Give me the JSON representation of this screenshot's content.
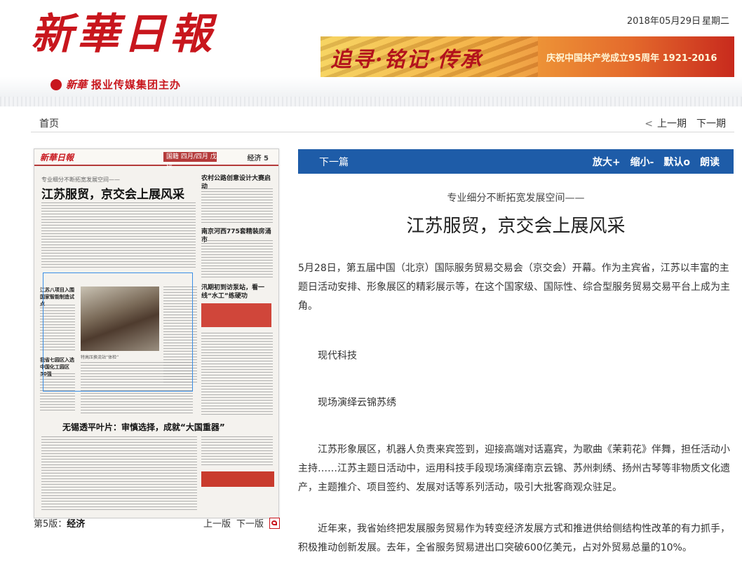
{
  "header": {
    "logo": "新華日報",
    "publisher_mark": "新華",
    "publisher": "报业传媒集团主办",
    "date": "2018年05月29日",
    "weekday": "星期二",
    "banner": {
      "main": "追寻·铭记·传承",
      "side": "庆祝中国共产党成立95周年 1921-2016"
    }
  },
  "nav": {
    "home": "首页",
    "prev_issue": "上一期",
    "next_issue": "下一期"
  },
  "thumbnail": {
    "logo": "新華日報",
    "tag": "国籍 四月/四月 戊戌",
    "edition": "经济 5",
    "kicker": "专业细分不断拓宽发展空间——",
    "headline": "江苏服贸，京交会上展风采",
    "side_headline_1": "农村公路创意设计大赛启动",
    "side_headline_2": "南京河西775套精装房涌市",
    "side_headline_3": "汛期初到访泵站，看一线“水工”练硬功",
    "brief_1": "江苏八项目入围国家智能制造试点",
    "brief_2": "我省七园区入选中国化工园区30强",
    "photo_caption": "特高压换流站“体检”",
    "bottom_headline": "无锡透平叶片：审慎选择，成就“大国重器”"
  },
  "page_footer": {
    "page_no": "第5版：",
    "page_name": "经济",
    "prev_page": "上一版",
    "next_page": "下一版"
  },
  "toolbar": {
    "next_article": "下一篇",
    "zoom_in": "放大+",
    "zoom_out": "缩小-",
    "default": "默认o",
    "read_aloud": "朗读"
  },
  "article": {
    "subtitle": "专业细分不断拓宽发展空间——",
    "title": "江苏服贸，京交会上展风采",
    "paragraphs": [
      "5月28日，第五届中国（北京）国际服务贸易交易会（京交会）开幕。作为主宾省，江苏以丰富的主题日活动安排、形象展区的精彩展示等，在这个国家级、国际性、综合型服务贸易交易平台上成为主角。",
      "现代科技",
      "现场演绎云锦苏绣",
      "江苏形象展区，机器人负责来宾签到，迎接高端对话嘉宾，为歌曲《茉莉花》伴舞，担任活动小主持……江苏主题日活动中，运用科技手段现场演绎南京云锦、苏州刺绣、扬州古琴等非物质文化遗产，主题推介、项目签约、发展对话等系列活动，吸引大批客商观众驻足。",
      "近年来，我省始终把发展服务贸易作为转变经济发展方式和推进供给侧结构性改革的有力抓手，积极推动创新发展。去年，全省服务贸易进出口突破600亿美元，占对外贸易总量的10%。"
    ]
  }
}
